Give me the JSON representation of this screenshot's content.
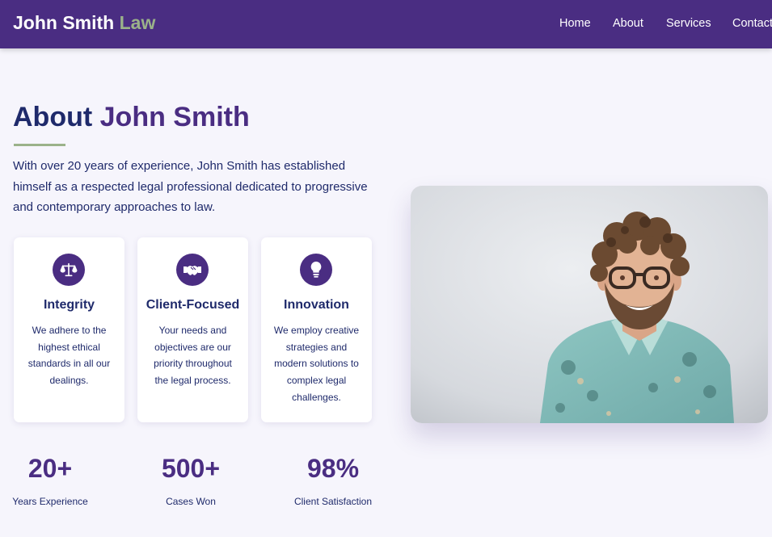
{
  "header": {
    "brand_main": "John Smith",
    "brand_accent": "Law",
    "nav": [
      "Home",
      "About",
      "Services",
      "Contact"
    ]
  },
  "about": {
    "title_prefix": "About",
    "title_name": "John Smith",
    "intro": "With over 20 years of experience, John Smith has established himself as a respected legal professional dedicated to progressive and contemporary approaches to law."
  },
  "cards": [
    {
      "icon": "scales-icon",
      "title": "Integrity",
      "text": "We adhere to the highest ethical standards in all our dealings."
    },
    {
      "icon": "handshake-icon",
      "title": "Client-Focused",
      "text": "Your needs and objectives are our priority throughout the legal process."
    },
    {
      "icon": "lightbulb-icon",
      "title": "Innovation",
      "text": "We employ creative strategies and modern solutions to complex legal challenges."
    }
  ],
  "stats": [
    {
      "value": "20+",
      "label": "Years Experience"
    },
    {
      "value": "500+",
      "label": "Cases Won"
    },
    {
      "value": "98%",
      "label": "Client Satisfaction"
    }
  ],
  "colors": {
    "primary": "#4a2d82",
    "navy": "#1f2a6b",
    "accent_green": "#9bb28a",
    "background": "#f6f5fc"
  }
}
